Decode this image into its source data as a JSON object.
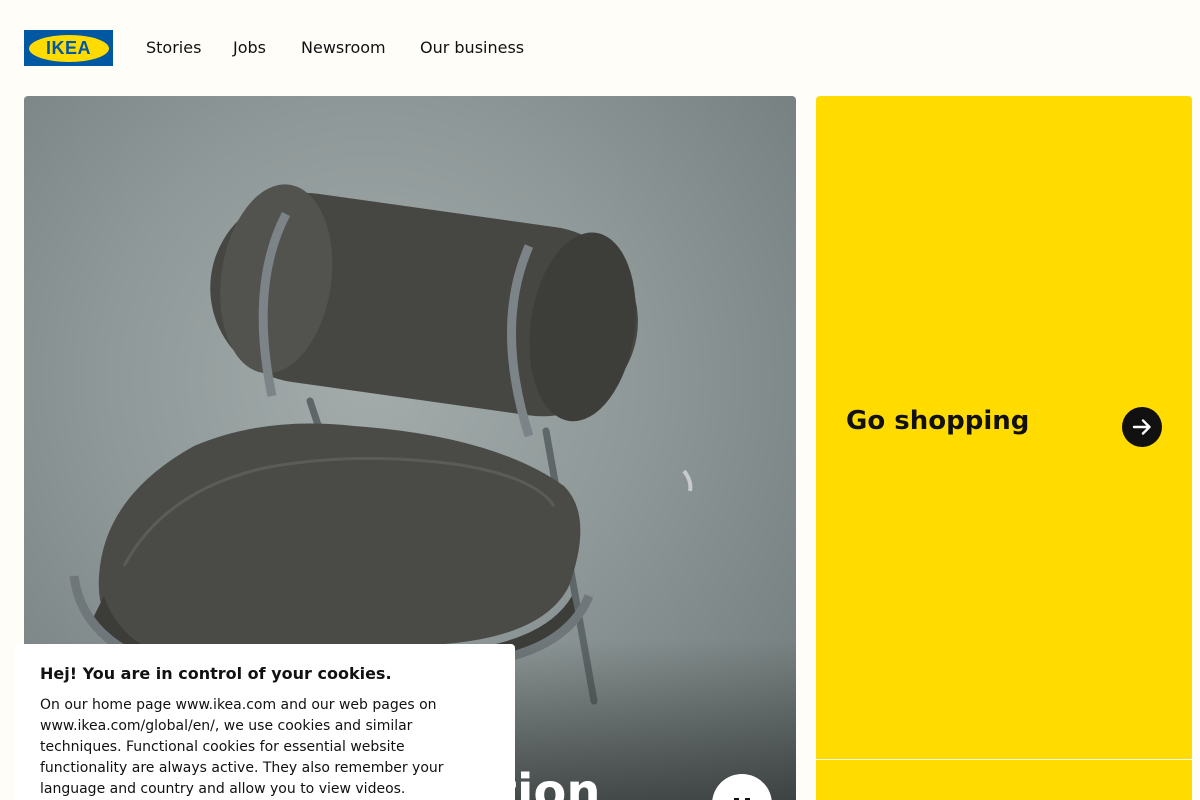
{
  "brand": {
    "logo_text": "IKEA",
    "color_blue": "#0058a3",
    "color_yellow": "#ffdb00"
  },
  "nav": {
    "items": [
      {
        "label": "Stories"
      },
      {
        "label": "Jobs"
      },
      {
        "label": "Newsroom"
      },
      {
        "label": "Our business"
      }
    ]
  },
  "hero": {
    "title": "tion",
    "pause_label": "Pause video",
    "pause_icon": "pause-icon"
  },
  "shop": {
    "title": "Go shopping",
    "arrow_icon": "arrow-right-icon"
  },
  "cookie": {
    "heading": "Hej! You are in control of your cookies.",
    "body": "On our home page www.ikea.com and our web pages on www.ikea.com/global/en/, we use cookies and similar techniques. Functional cookies for essential website functionality are always active. They also remember your language and country and allow you to view videos."
  }
}
